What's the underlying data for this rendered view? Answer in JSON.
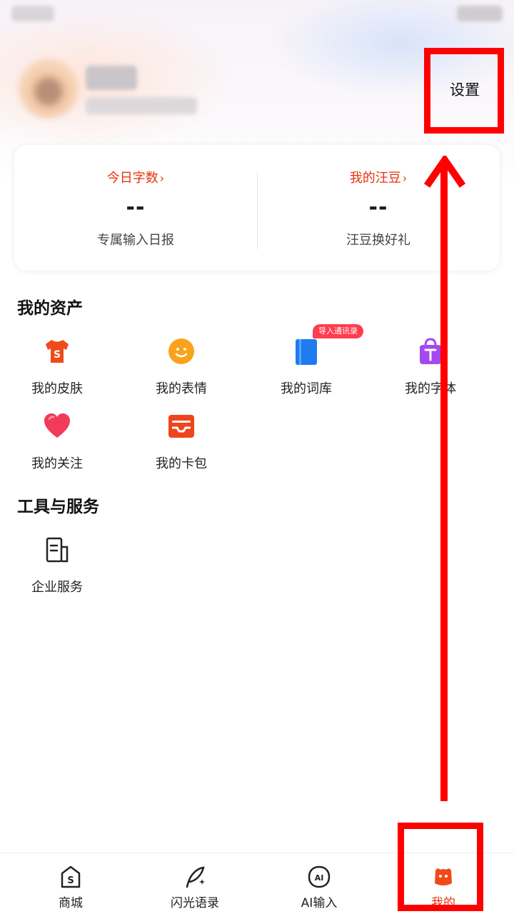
{
  "header": {
    "settings_label": "设置"
  },
  "stats": [
    {
      "title": "今日字数",
      "chevron": "›",
      "value": "--",
      "subtitle": "专属输入日报"
    },
    {
      "title": "我的汪豆",
      "chevron": "›",
      "value": "--",
      "subtitle": "汪豆换好礼"
    }
  ],
  "assets": {
    "title": "我的资产",
    "items": [
      {
        "label": "我的皮肤",
        "icon": "skin-shirt-icon"
      },
      {
        "label": "我的表情",
        "icon": "emoji-face-icon"
      },
      {
        "label": "我的词库",
        "icon": "dictionary-book-icon",
        "badge": "导入通讯录"
      },
      {
        "label": "我的字体",
        "icon": "font-bag-icon"
      },
      {
        "label": "我的关注",
        "icon": "heart-icon"
      },
      {
        "label": "我的卡包",
        "icon": "card-wallet-icon"
      }
    ]
  },
  "tools": {
    "title": "工具与服务",
    "items": [
      {
        "label": "企业服务",
        "icon": "enterprise-document-icon"
      }
    ]
  },
  "tabbar": {
    "items": [
      {
        "label": "商城",
        "icon": "shop-icon",
        "active": false
      },
      {
        "label": "闪光语录",
        "icon": "feather-quote-icon",
        "active": false
      },
      {
        "label": "AI输入",
        "icon": "ai-input-icon",
        "active": false
      },
      {
        "label": "我的",
        "icon": "profile-dog-icon",
        "active": true
      }
    ]
  },
  "annotation": {
    "color": "#ff0000"
  },
  "colors": {
    "accent": "#e8320e"
  }
}
